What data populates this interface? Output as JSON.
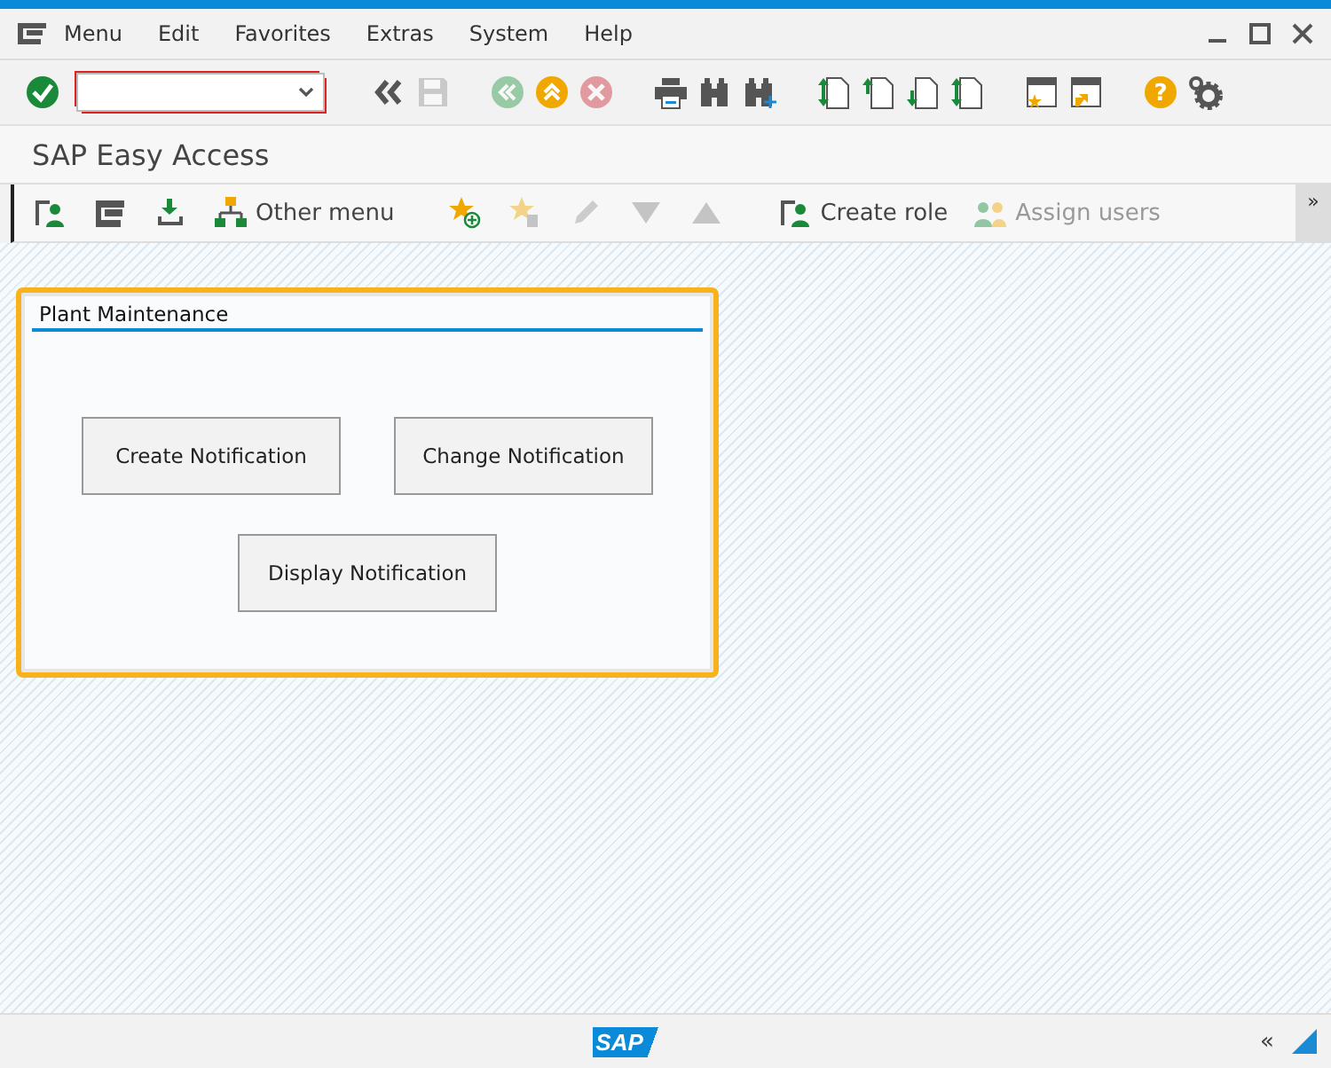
{
  "menu_bar": {
    "items": [
      "Menu",
      "Edit",
      "Favorites",
      "Extras",
      "System",
      "Help"
    ]
  },
  "system_toolbar": {
    "buttons": [
      {
        "disabled": false
      },
      {
        "disabled": false
      },
      {
        "disabled": true
      },
      {
        "disabled": true
      },
      {
        "disabled": false
      },
      {
        "disabled": true
      },
      {
        "disabled": false
      },
      {
        "disabled": false
      },
      {
        "disabled": false
      },
      {
        "disabled": false
      },
      {
        "disabled": false
      },
      {
        "disabled": false
      },
      {
        "disabled": false
      },
      {
        "disabled": false
      },
      {
        "disabled": false
      },
      {
        "disabled": false
      },
      {
        "disabled": false
      }
    ],
    "help_glyph": "?"
  },
  "screen_title": "SAP Easy Access",
  "application_toolbar": {
    "items": [
      {
        "disabled": false
      },
      {
        "disabled": false
      },
      {
        "disabled": false
      },
      {
        "label": "Other menu",
        "disabled": false
      },
      {
        "disabled": false
      },
      {
        "disabled": true
      },
      {
        "disabled": true
      },
      {
        "disabled": true
      },
      {
        "disabled": true
      },
      {
        "label": "Create role",
        "disabled": false
      },
      {
        "label": "Assign users",
        "disabled": true
      }
    ],
    "overflow": "»"
  },
  "panel": {
    "title": "Plant Maintenance",
    "buttons": [
      "Create Notification",
      "Change Notification",
      "Display Notification"
    ]
  },
  "status_bar": {
    "logo": "SAP",
    "collapse": "«"
  }
}
